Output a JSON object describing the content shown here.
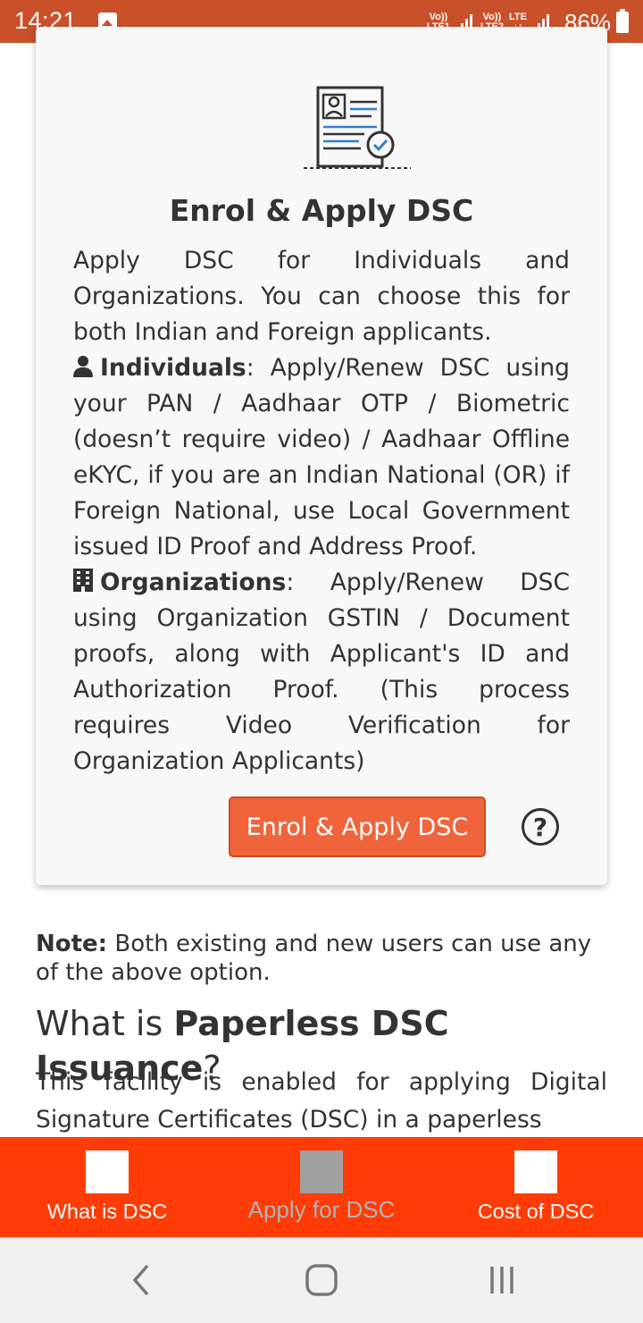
{
  "status_bar": {
    "time": "14:21",
    "sim1_label_top": "Vo))",
    "sim1_label_bottom": "LTE1",
    "sim2_label_top": "Vo))",
    "sim2_label_bottom": "LTE2",
    "network_type": "LTE",
    "battery_percent": "86%"
  },
  "card": {
    "title": "Enrol & Apply DSC",
    "intro": "Apply DSC for Individuals and Organizations. You can choose this for both Indian and Foreign applicants.",
    "individuals_label": "Individuals",
    "individuals_text": ": Apply/Renew DSC using your PAN / Aadhaar OTP / Biometric (doesn’t require video) / Aadhaar Offline eKYC, if you are an Indian National (OR) if Foreign National, use Local Government issued ID Proof and Address Proof.",
    "organizations_label": "Organizations",
    "organizations_text": ": Apply/Renew DSC using Organization GSTIN / Document proofs, along with Applicant's ID and Authorization Proof. (This process requires Video Verification for Organization Applicants)",
    "button_label": "Enrol & Apply DSC",
    "help_symbol": "?"
  },
  "note": {
    "label": "Note:",
    "text": " Both existing and new users can use any of the above option."
  },
  "section": {
    "heading_prefix": "What is ",
    "heading_bold": "Paperless DSC Issuance",
    "heading_suffix": "?",
    "text": "This facility is enabled for applying Digital Signature Certificates (DSC) in a paperless"
  },
  "bottom_nav": {
    "items": [
      {
        "label": "What is DSC",
        "icon": "placeholder-icon",
        "active": false
      },
      {
        "label": "Apply for DSC",
        "icon": "placeholder-icon",
        "active": true
      },
      {
        "label": "Cost of DSC",
        "icon": "placeholder-icon",
        "active": false
      }
    ]
  },
  "system_nav": {
    "icons": [
      "back-icon",
      "home-icon",
      "recents-icon"
    ]
  },
  "colors": {
    "status_bar": "#c9512a",
    "button": "#f0643c",
    "bottom_nav": "#ff3c07",
    "text": "#333333"
  }
}
